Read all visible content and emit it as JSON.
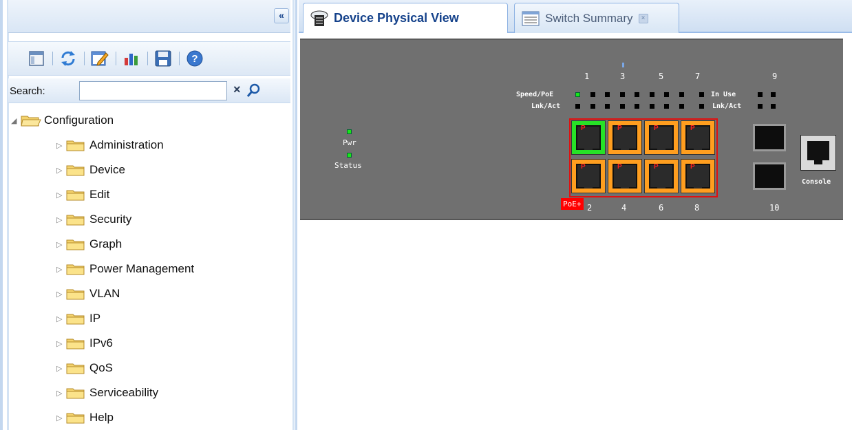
{
  "sidebar": {
    "collapse_label": "«",
    "toolbar_icons": [
      "layout-icon",
      "refresh-icon",
      "edit-icon",
      "chart-icon",
      "save-icon",
      "help-icon"
    ],
    "search": {
      "label": "Search:",
      "value": "",
      "placeholder": ""
    },
    "tree": {
      "root": "Configuration",
      "children": [
        "Administration",
        "Device",
        "Edit",
        "Security",
        "Graph",
        "Power Management",
        "VLAN",
        "IP",
        "IPv6",
        "QoS",
        "Serviceability",
        "Help"
      ]
    }
  },
  "tabs": [
    {
      "label": "Device Physical View",
      "active": true
    },
    {
      "label": "Switch Summary",
      "active": false,
      "close": "×"
    }
  ],
  "device": {
    "pwr_label": "Pwr",
    "status_label": "Status",
    "speed_poe_label": "Speed/PoE",
    "lnk_act_label": "Lnk/Act",
    "in_use_label": "In Use",
    "lnk_act_label2": "Lnk/Act",
    "top_port_numbers": [
      "1",
      "3",
      "5",
      "7"
    ],
    "bottom_port_numbers": [
      "2",
      "4",
      "6",
      "8"
    ],
    "sfp_top_number": "9",
    "sfp_bottom_number": "10",
    "poe_badge": "PoE+",
    "console_label": "Console",
    "port_letter": "P",
    "colors": {
      "poe_port": "#ff9e1f",
      "active_port": "#27e227",
      "led_on": "#19e619",
      "panel": "#707070",
      "poe_badge": "#ff0000"
    }
  }
}
